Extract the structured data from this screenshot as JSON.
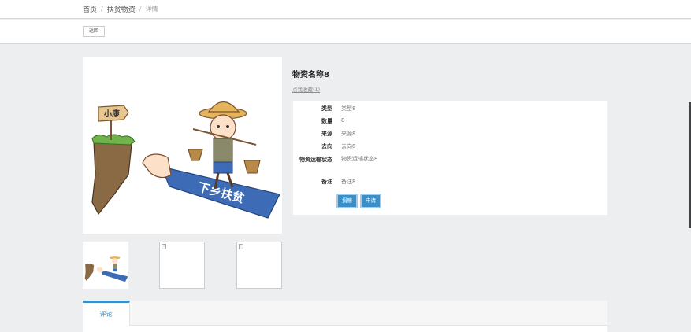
{
  "breadcrumb": {
    "home": "首页",
    "separator": "/",
    "section": "扶贫物资",
    "current": "详情"
  },
  "toolbar": {
    "back_label": "返回"
  },
  "product": {
    "title": "物资名称8",
    "favorite_link": "点我收藏(1)",
    "main_image_icon": "poverty-alleviation-cartoon-icon",
    "main_image_text": {
      "sign": "小康",
      "banner": "下乡扶贫"
    },
    "thumbnails": [
      {
        "icon": "poverty-alleviation-cartoon-icon"
      },
      {
        "icon": "broken-image-icon"
      },
      {
        "icon": "broken-image-icon"
      }
    ]
  },
  "details": {
    "rows": [
      {
        "label": "类型",
        "value": "类型8"
      },
      {
        "label": "数量",
        "value": "8"
      },
      {
        "label": "来源",
        "value": "来源8"
      },
      {
        "label": "去向",
        "value": "去向8"
      },
      {
        "label": "物资运输状态",
        "value": "物资运输状态8"
      },
      {
        "label": "备注",
        "value": "备注8"
      }
    ],
    "donate_label": "捐赠",
    "apply_label": "申请"
  },
  "tabs": [
    {
      "label": "评论"
    }
  ],
  "colors": {
    "accent": "#3a8fc8",
    "background": "#eceef0"
  }
}
